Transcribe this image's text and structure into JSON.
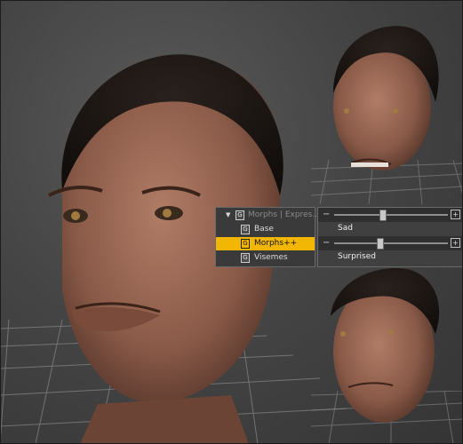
{
  "morph_panel": {
    "header": {
      "arrow": "▼",
      "icon_glyph": "G",
      "label": "Morphs | Expres..."
    },
    "items": [
      {
        "icon_glyph": "G",
        "label": "Base",
        "selected": false
      },
      {
        "icon_glyph": "G",
        "label": "Morphs++",
        "selected": true
      },
      {
        "icon_glyph": "G",
        "label": "Visemes",
        "selected": false
      }
    ]
  },
  "sliders": [
    {
      "name": "Sad",
      "minus": "−",
      "plus": "+",
      "value": 0.42
    },
    {
      "name": "Surprised",
      "minus": "−",
      "plus": "+",
      "value": 0.4
    }
  ],
  "colors": {
    "selection": "#f2b705",
    "background": "#474747",
    "grid": "#a0a0a0"
  }
}
